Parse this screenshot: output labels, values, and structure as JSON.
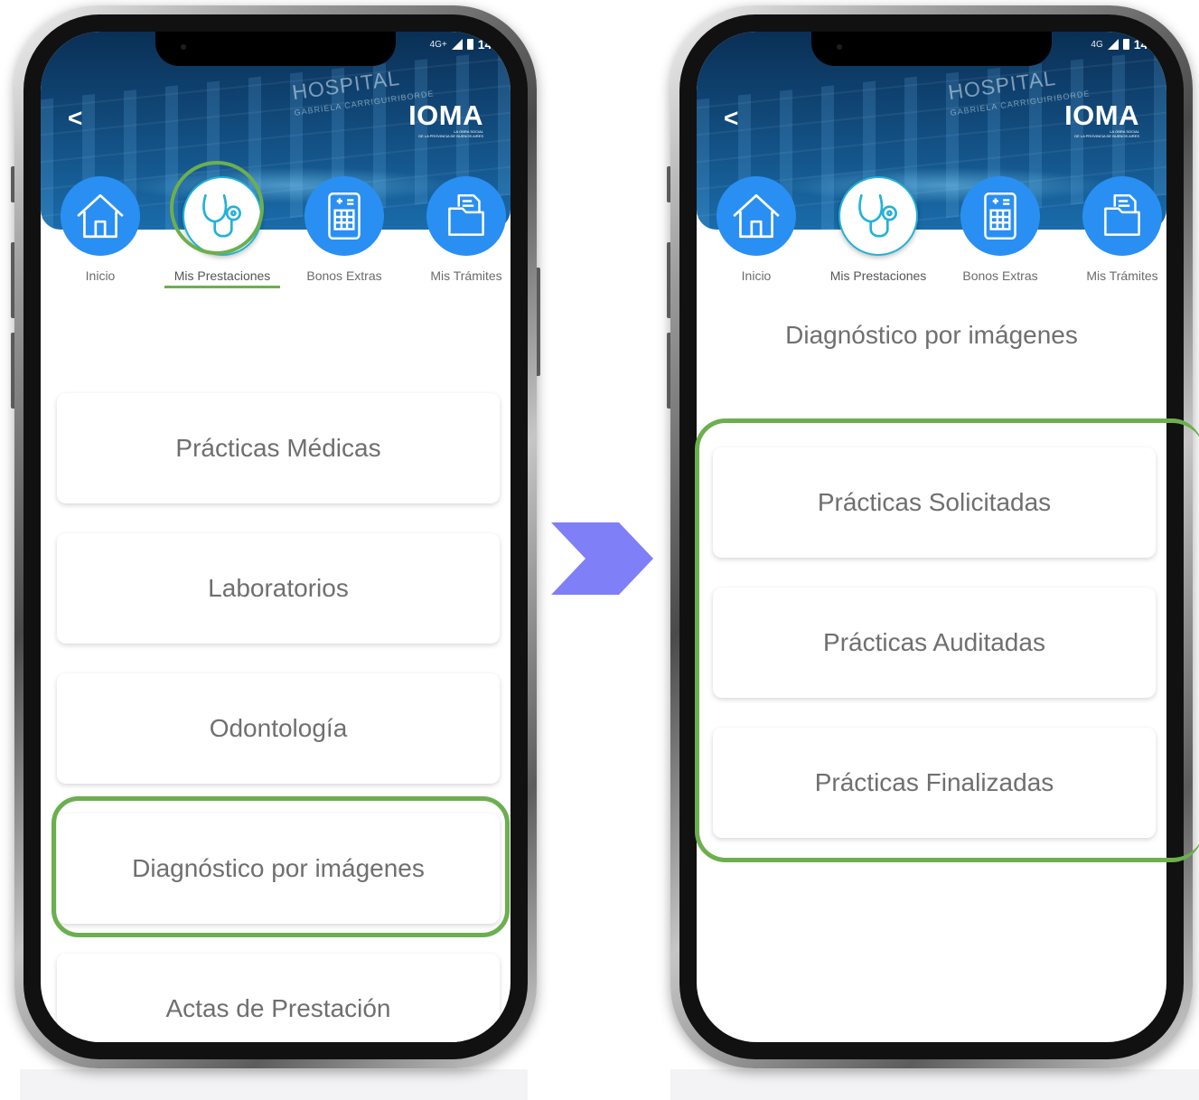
{
  "status_bar": {
    "network_left": "4G+",
    "network_right": "4G",
    "time": "14:"
  },
  "header": {
    "back_symbol": "<",
    "building_text": "HOSPITAL",
    "building_subtext": "GABRIELA CARRIGUIRIBORDE",
    "brand_name": "IOMA",
    "brand_subline_1": "LA OBRA SOCIAL",
    "brand_subline_2": "DE LA PROVINCIA DE BUENOS AIRES"
  },
  "nav": {
    "items": [
      {
        "label": "Inicio",
        "icon": "home-icon"
      },
      {
        "label": "Mis Prestaciones",
        "icon": "stethoscope-icon"
      },
      {
        "label": "Bonos Extras",
        "icon": "tablet-calculator-icon"
      },
      {
        "label": "Mis Trámites",
        "icon": "folder-documents-icon"
      }
    ],
    "active_index": 1
  },
  "left_screen": {
    "menu_items": [
      "Prácticas Médicas",
      "Laboratorios",
      "Odontología",
      "Diagnóstico por imágenes",
      "Actas de Prestación"
    ],
    "highlighted_item": "Diagnóstico por imágenes"
  },
  "right_screen": {
    "title": "Diagnóstico por imágenes",
    "menu_items": [
      "Prácticas Solicitadas",
      "Prácticas Auditadas",
      "Prácticas Finalizadas"
    ]
  },
  "colors": {
    "highlight_green": "#6caf4e",
    "icon_blue": "#2a8ff2",
    "header_blue": "#11497a",
    "arrow_purple": "#7f7ff7",
    "text_gray": "#6f6f6f"
  }
}
